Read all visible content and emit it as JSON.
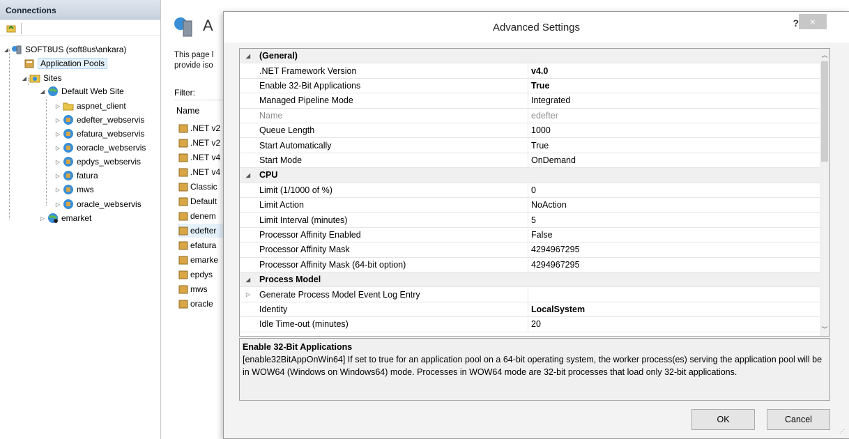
{
  "connections": {
    "header": "Connections",
    "tree": {
      "server": "SOFT8US (soft8us\\ankara)",
      "app_pools": "Application Pools",
      "sites": "Sites",
      "default_site": "Default Web Site",
      "children": [
        "aspnet_client",
        "edefter_webservis",
        "efatura_webservis",
        "eoracle_webservis",
        "epdys_webservis",
        "fatura",
        "mws",
        "oracle_webservis"
      ],
      "emarket": "emarket"
    }
  },
  "middle": {
    "title": "A",
    "desc": "This page l provide iso",
    "filter_label": "Filter:",
    "name_header": "Name",
    "pools": [
      ".NET v2",
      ".NET v2",
      ".NET v4",
      ".NET v4",
      "Classic",
      "Default",
      "denem",
      "edefter",
      "efatura",
      "emarke",
      "epdys",
      "mws",
      "oracle"
    ]
  },
  "dialog": {
    "title": "Advanced Settings",
    "help": "?",
    "close": "×",
    "rows": [
      {
        "kind": "cat",
        "exp": "◢",
        "name": "(General)",
        "value": ""
      },
      {
        "kind": "prop",
        "name": ".NET Framework Version",
        "value": "v4.0",
        "bold": true
      },
      {
        "kind": "prop",
        "name": "Enable 32-Bit Applications",
        "value": "True",
        "bold": true
      },
      {
        "kind": "prop",
        "name": "Managed Pipeline Mode",
        "value": "Integrated"
      },
      {
        "kind": "prop",
        "name": "Name",
        "value": "edefter",
        "disabled": true
      },
      {
        "kind": "prop",
        "name": "Queue Length",
        "value": "1000"
      },
      {
        "kind": "prop",
        "name": "Start Automatically",
        "value": "True"
      },
      {
        "kind": "prop",
        "name": "Start Mode",
        "value": "OnDemand"
      },
      {
        "kind": "cat",
        "exp": "◢",
        "name": "CPU",
        "value": ""
      },
      {
        "kind": "prop",
        "name": "Limit (1/1000 of %)",
        "value": "0"
      },
      {
        "kind": "prop",
        "name": "Limit Action",
        "value": "NoAction"
      },
      {
        "kind": "prop",
        "name": "Limit Interval (minutes)",
        "value": "5"
      },
      {
        "kind": "prop",
        "name": "Processor Affinity Enabled",
        "value": "False"
      },
      {
        "kind": "prop",
        "name": "Processor Affinity Mask",
        "value": "4294967295"
      },
      {
        "kind": "prop",
        "name": "Processor Affinity Mask (64-bit option)",
        "value": "4294967295"
      },
      {
        "kind": "cat",
        "exp": "◢",
        "name": "Process Model",
        "value": ""
      },
      {
        "kind": "prop",
        "exp": "▷",
        "name": "Generate Process Model Event Log Entry",
        "value": ""
      },
      {
        "kind": "prop",
        "name": "Identity",
        "value": "LocalSystem",
        "bold": true
      },
      {
        "kind": "prop",
        "name": "Idle Time-out (minutes)",
        "value": "20"
      }
    ],
    "description": {
      "title": "Enable 32-Bit Applications",
      "text": "[enable32BitAppOnWin64] If set to true for an application pool on a 64-bit operating system, the worker process(es) serving the application pool will be in WOW64 (Windows on Windows64) mode. Processes in WOW64 mode are 32-bit processes that load only 32-bit applications."
    },
    "ok_label": "OK",
    "cancel_label": "Cancel"
  },
  "icons": {
    "server": "server-icon",
    "app_pool": "app-pool-icon",
    "folder": "folder-icon",
    "globe": "globe-icon"
  },
  "colors": {
    "selection": "#e5f1fb",
    "category_bg": "#f0f0f0",
    "close_button": "#c7c7c7"
  }
}
